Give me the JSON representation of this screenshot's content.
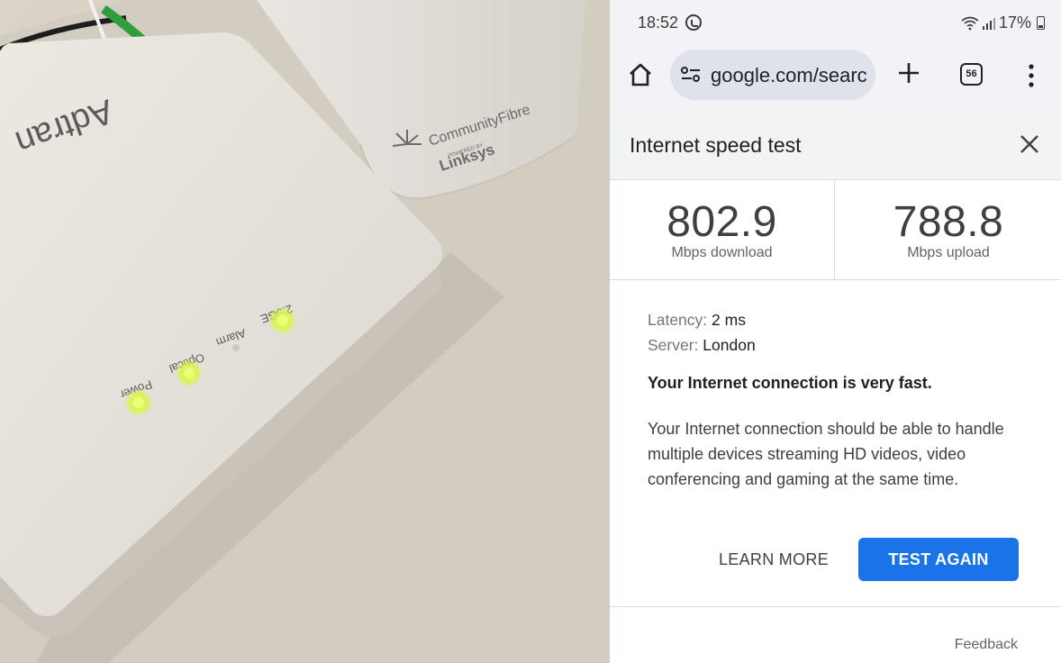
{
  "photo": {
    "router_brand": "Adtran",
    "hub_brand": "CommunityFibre",
    "hub_powered_by": "POWERED BY",
    "hub_partner": "Linksys",
    "led_labels": [
      "Power",
      "Optical",
      "Alarm",
      "2.5GE"
    ],
    "led_color": "#d8f54a"
  },
  "status_bar": {
    "time": "18:52",
    "battery": "17%"
  },
  "browser": {
    "url": "google.com/search",
    "tab_count": "56"
  },
  "card": {
    "title": "Internet speed test",
    "download": {
      "value": "802.9",
      "label": "Mbps download"
    },
    "upload": {
      "value": "788.8",
      "label": "Mbps upload"
    },
    "latency": {
      "label": "Latency:",
      "value": "2 ms"
    },
    "server": {
      "label": "Server:",
      "value": "London"
    },
    "verdict": "Your Internet connection is very fast.",
    "description": "Your Internet connection should be able to handle multiple devices streaming HD videos, video conferencing and gaming at the same time.",
    "learn_more": "LEARN MORE",
    "test_again": "TEST AGAIN",
    "feedback": "Feedback"
  },
  "colors": {
    "accent": "#1a73e8",
    "header_bg": "#f1f3f4"
  }
}
